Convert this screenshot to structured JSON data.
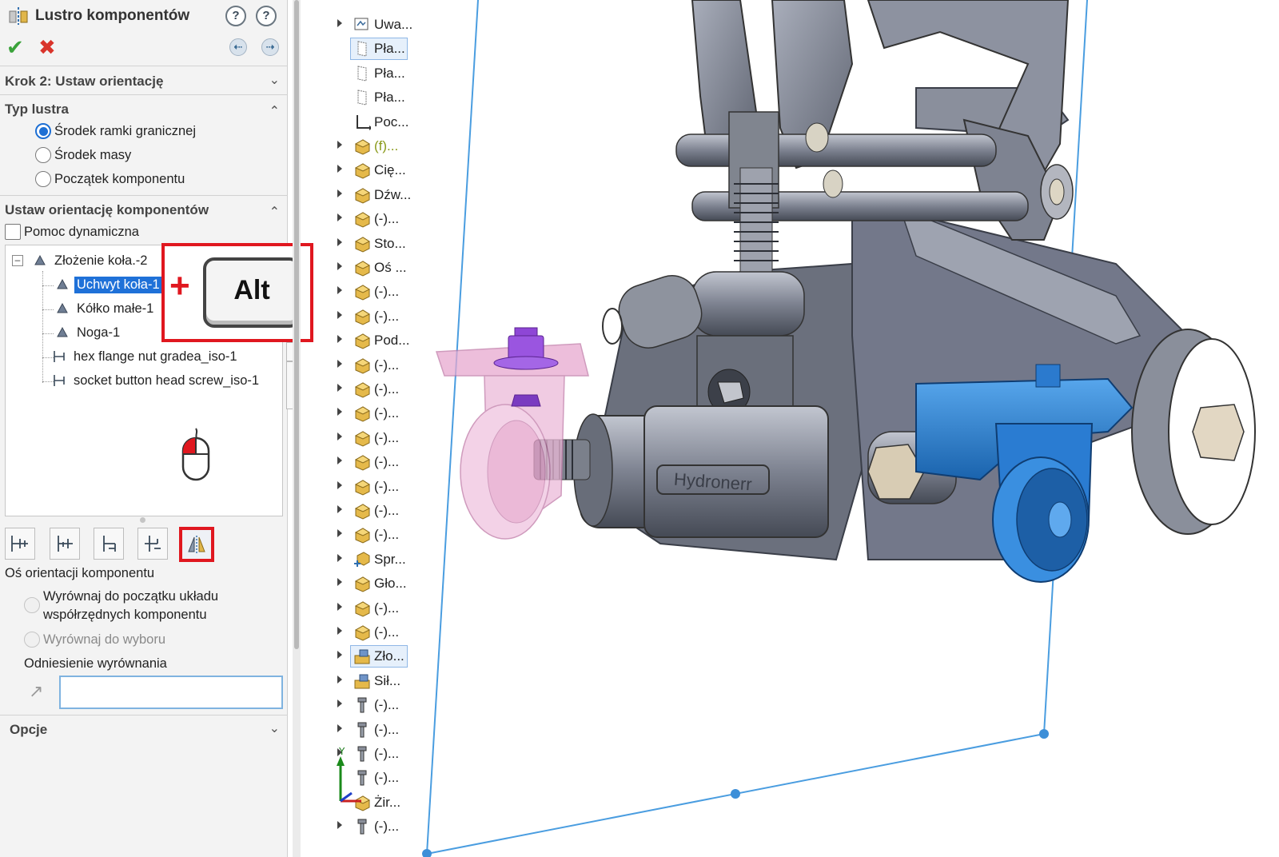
{
  "panel": {
    "title": "Lustro komponentów",
    "step_header": "Krok 2: Ustaw orientację",
    "mirror_type": {
      "header": "Typ lustra",
      "options": [
        {
          "label": "Środek ramki granicznej",
          "selected": true
        },
        {
          "label": "Środek masy",
          "selected": false
        },
        {
          "label": "Początek komponentu",
          "selected": false
        }
      ]
    },
    "orient": {
      "header": "Ustaw orientację komponentów",
      "dynamic_help": "Pomoc dynamiczna",
      "tree": {
        "root": "Złożenie koła.-2",
        "children": [
          {
            "label": "Uchwyt koła-1",
            "selected": true
          },
          {
            "label": "Kółko małe-1",
            "selected": false
          },
          {
            "label": "Noga-1",
            "selected": false
          },
          {
            "label": "hex flange nut gradea_iso-1",
            "selected": false
          },
          {
            "label": "socket button head screw_iso-1",
            "selected": false
          }
        ]
      },
      "hint_key": "Alt",
      "hint_plus": "+"
    },
    "axis": {
      "label": "Oś orientacji komponentu",
      "opt1_line1": "Wyrównaj do początku układu",
      "opt1_line2": "współrzędnych komponentu",
      "opt2": "Wyrównaj do wyboru",
      "ref_label": "Odniesienie wyrównania",
      "ref_value": ""
    },
    "options_header": "Opcje"
  },
  "feature_tree": [
    {
      "label": "Uwa...",
      "icon": "annotations-icon",
      "arrow": true,
      "highlight": false
    },
    {
      "label": "Pła...",
      "icon": "plane-icon",
      "arrow": false,
      "highlight": true
    },
    {
      "label": "Pła...",
      "icon": "plane-icon",
      "arrow": false,
      "highlight": false
    },
    {
      "label": "Pła...",
      "icon": "plane-icon",
      "arrow": false,
      "highlight": false
    },
    {
      "label": "Poc...",
      "icon": "origin-icon",
      "arrow": false,
      "highlight": false
    },
    {
      "label": "(f)...",
      "icon": "part-icon",
      "arrow": true,
      "highlight": false,
      "green": true
    },
    {
      "label": "Cię...",
      "icon": "part-icon",
      "arrow": true,
      "highlight": false
    },
    {
      "label": "Dźw...",
      "icon": "part-icon",
      "arrow": true,
      "highlight": false
    },
    {
      "label": "(-)...",
      "icon": "part-icon",
      "arrow": true,
      "highlight": false
    },
    {
      "label": "Sto...",
      "icon": "part-icon",
      "arrow": true,
      "highlight": false
    },
    {
      "label": "Oś ...",
      "icon": "part-icon",
      "arrow": true,
      "highlight": false
    },
    {
      "label": "(-)...",
      "icon": "part-icon",
      "arrow": true,
      "highlight": false
    },
    {
      "label": "(-)...",
      "icon": "part-icon",
      "arrow": true,
      "highlight": false
    },
    {
      "label": "Pod...",
      "icon": "part-icon",
      "arrow": true,
      "highlight": false
    },
    {
      "label": "(-)...",
      "icon": "part-icon",
      "arrow": true,
      "highlight": false
    },
    {
      "label": "(-)...",
      "icon": "part-icon",
      "arrow": true,
      "highlight": false
    },
    {
      "label": "(-)...",
      "icon": "part-icon",
      "arrow": true,
      "highlight": false
    },
    {
      "label": "(-)...",
      "icon": "part-icon",
      "arrow": true,
      "highlight": false
    },
    {
      "label": "(-)...",
      "icon": "part-icon",
      "arrow": true,
      "highlight": false
    },
    {
      "label": "(-)...",
      "icon": "part-icon",
      "arrow": true,
      "highlight": false
    },
    {
      "label": "(-)...",
      "icon": "part-icon",
      "arrow": true,
      "highlight": false
    },
    {
      "label": "(-)...",
      "icon": "part-icon",
      "arrow": true,
      "highlight": false
    },
    {
      "label": "Spr...",
      "icon": "spring-icon",
      "arrow": true,
      "highlight": false
    },
    {
      "label": "Gło...",
      "icon": "part-icon",
      "arrow": true,
      "highlight": false
    },
    {
      "label": "(-)...",
      "icon": "part-icon",
      "arrow": true,
      "highlight": false
    },
    {
      "label": "(-)...",
      "icon": "part-icon",
      "arrow": true,
      "highlight": false
    },
    {
      "label": "Zło...",
      "icon": "assembly-icon",
      "arrow": true,
      "highlight": true
    },
    {
      "label": "Sił...",
      "icon": "assembly-icon",
      "arrow": true,
      "highlight": false
    },
    {
      "label": "(-)...",
      "icon": "screw-icon",
      "arrow": true,
      "highlight": false
    },
    {
      "label": "(-)...",
      "icon": "screw-icon",
      "arrow": true,
      "highlight": false
    },
    {
      "label": "(-)...",
      "icon": "screw-icon",
      "arrow": true,
      "highlight": false
    },
    {
      "label": "(-)...",
      "icon": "screw-icon",
      "arrow": false,
      "highlight": false
    },
    {
      "label": "Żir...",
      "icon": "part-icon",
      "arrow": false,
      "highlight": false
    },
    {
      "label": "(-)...",
      "icon": "screw-icon",
      "arrow": true,
      "highlight": false
    }
  ],
  "model": {
    "brand_text": "Hydronerr",
    "colors": {
      "metal": "#7d8290",
      "metal_dark": "#4d525e",
      "metal_light": "#a8adba",
      "selected_blue": "#2f86d6",
      "mirror_pink": "#e7a9cf",
      "preview_purple": "#8e46d6",
      "bbox_line": "#4a9de0"
    }
  }
}
